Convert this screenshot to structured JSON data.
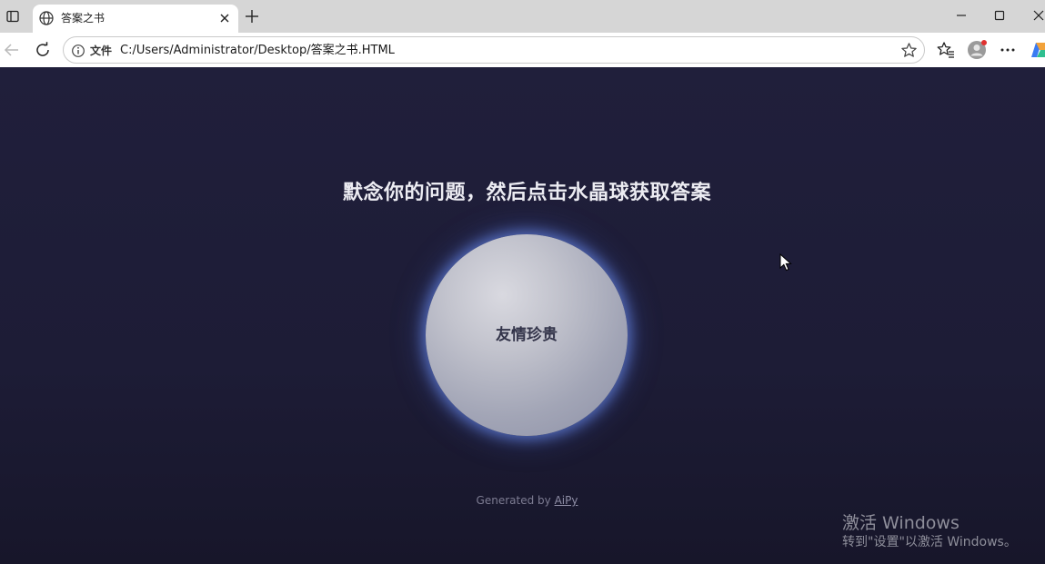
{
  "browser": {
    "tab": {
      "title": "答案之书"
    },
    "address": {
      "site_label": "文件",
      "url": "C:/Users/Administrator/Desktop/答案之书.HTML"
    }
  },
  "page": {
    "prompt": "默念你的问题，然后点击水晶球获取答案",
    "answer": "友情珍贵",
    "footer": {
      "prefix": "Generated by ",
      "link_text": "AiPy"
    }
  },
  "os": {
    "activation_title": "激活 Windows",
    "activation_subtitle": "转到\"设置\"以激活 Windows。"
  },
  "icons": {
    "tab_actions": "tab-actions-icon",
    "favicon": "globe-icon",
    "tab_close": "close-icon",
    "new_tab": "plus-icon",
    "minimize": "minimize-icon",
    "maximize": "maximize-icon",
    "window_close": "close-icon",
    "back": "arrow-left-icon",
    "reload": "reload-icon",
    "site_info": "info-icon",
    "favorite": "star-icon",
    "favorites": "favorites-icon",
    "profile": "avatar-icon",
    "more": "more-icon",
    "copilot": "copilot-icon",
    "cursor": "mouse-cursor-icon"
  },
  "colors": {
    "page_background": "#1e1d36",
    "ball_glow": "#607cd6",
    "prompt_text": "#ececf2"
  }
}
